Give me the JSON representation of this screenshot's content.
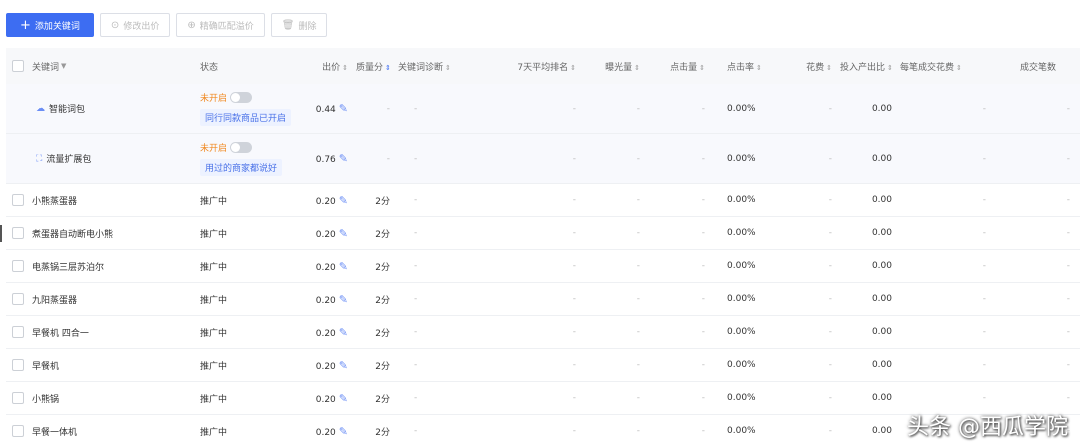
{
  "toolbar": {
    "add_keyword": "添加关键词",
    "modify_bid": "修改出价",
    "precise_match_bid": "精确匹配溢价",
    "delete": "删除"
  },
  "header": {
    "keyword": "关键词",
    "status": "状态",
    "bid": "出价",
    "quality": "质量分",
    "diagnosis": "关键词诊断",
    "rank": "7天平均排名",
    "exposure": "曝光量",
    "clicks": "点击量",
    "ctr": "点击率",
    "cost": "花费",
    "roi": "投入产出比",
    "cpa": "每笔成交花费",
    "conversions": "成交笔数"
  },
  "special_rows": [
    {
      "keyword": "智能词包",
      "icon": "cloud-icon",
      "status": "未开启",
      "tag": "同行同款商品已开启",
      "bid": "0.44",
      "quality": "-",
      "diagnosis": "-",
      "rank": "-",
      "exposure": "-",
      "clicks": "-",
      "ctr": "0.00%",
      "cost": "-",
      "roi": "0.00",
      "cpa": "-",
      "conversions": "-"
    },
    {
      "keyword": "流量扩展包",
      "icon": "expand-icon",
      "status": "未开启",
      "tag": "用过的商家都说好",
      "bid": "0.76",
      "quality": "-",
      "diagnosis": "-",
      "rank": "-",
      "exposure": "-",
      "clicks": "-",
      "ctr": "0.00%",
      "cost": "-",
      "roi": "0.00",
      "cpa": "-",
      "conversions": "-"
    }
  ],
  "rows": [
    {
      "keyword": "小熊蒸蛋器",
      "status": "推广中",
      "bid": "0.20",
      "quality": "2分",
      "diagnosis": "-",
      "rank": "-",
      "exposure": "-",
      "clicks": "-",
      "ctr": "0.00%",
      "cost": "-",
      "roi": "0.00",
      "cpa": "-",
      "conversions": "-"
    },
    {
      "keyword": "煮蛋器自动断电小熊",
      "status": "推广中",
      "bid": "0.20",
      "quality": "2分",
      "diagnosis": "-",
      "rank": "-",
      "exposure": "-",
      "clicks": "-",
      "ctr": "0.00%",
      "cost": "-",
      "roi": "0.00",
      "cpa": "-",
      "conversions": "-"
    },
    {
      "keyword": "电蒸锅三层苏泊尔",
      "status": "推广中",
      "bid": "0.20",
      "quality": "2分",
      "diagnosis": "-",
      "rank": "-",
      "exposure": "-",
      "clicks": "-",
      "ctr": "0.00%",
      "cost": "-",
      "roi": "0.00",
      "cpa": "-",
      "conversions": "-"
    },
    {
      "keyword": "九阳蒸蛋器",
      "status": "推广中",
      "bid": "0.20",
      "quality": "2分",
      "diagnosis": "-",
      "rank": "-",
      "exposure": "-",
      "clicks": "-",
      "ctr": "0.00%",
      "cost": "-",
      "roi": "0.00",
      "cpa": "-",
      "conversions": "-"
    },
    {
      "keyword": "早餐机 四合一",
      "status": "推广中",
      "bid": "0.20",
      "quality": "2分",
      "diagnosis": "-",
      "rank": "-",
      "exposure": "-",
      "clicks": "-",
      "ctr": "0.00%",
      "cost": "-",
      "roi": "0.00",
      "cpa": "-",
      "conversions": "-"
    },
    {
      "keyword": "早餐机",
      "status": "推广中",
      "bid": "0.20",
      "quality": "2分",
      "diagnosis": "-",
      "rank": "-",
      "exposure": "-",
      "clicks": "-",
      "ctr": "0.00%",
      "cost": "-",
      "roi": "0.00",
      "cpa": "-",
      "conversions": "-"
    },
    {
      "keyword": "小熊锅",
      "status": "推广中",
      "bid": "0.20",
      "quality": "2分",
      "diagnosis": "-",
      "rank": "-",
      "exposure": "-",
      "clicks": "-",
      "ctr": "0.00%",
      "cost": "-",
      "roi": "0.00",
      "cpa": "-",
      "conversions": "-"
    },
    {
      "keyword": "早餐一体机",
      "status": "推广中",
      "bid": "0.20",
      "quality": "2分",
      "diagnosis": "-",
      "rank": "-",
      "exposure": "-",
      "clicks": "-",
      "ctr": "0.00%",
      "cost": "-",
      "roi": "0.00",
      "cpa": "-",
      "conversions": "-"
    }
  ],
  "watermark": "头条 @西瓜学院"
}
